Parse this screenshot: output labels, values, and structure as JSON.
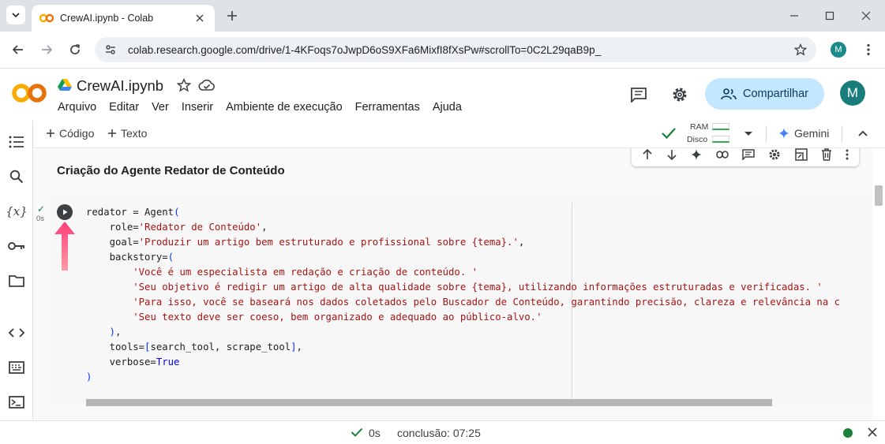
{
  "browser": {
    "tab_title": "CrewAI.ipynb - Colab",
    "url": "colab.research.google.com/drive/1-4KFoqs7oJwpD6oS9XFa6MixfI8fXsPw#scrollTo=0C2L29qaB9p_",
    "profile_initial": "M"
  },
  "header": {
    "logo_text": "CO",
    "notebook_title": "CrewAI.ipynb",
    "menu": [
      "Arquivo",
      "Editar",
      "Ver",
      "Inserir",
      "Ambiente de execução",
      "Ferramentas",
      "Ajuda"
    ],
    "share_label": "Compartilhar",
    "avatar_initial": "M"
  },
  "toolbar": {
    "add_code": "Código",
    "add_text": "Texto",
    "ram_label": "RAM",
    "disk_label": "Disco",
    "gemini_label": "Gemini"
  },
  "notebook": {
    "heading": "Criação do Agente Redator de Conteúdo",
    "exec_time": "0s",
    "code_lines": [
      "redator = Agent(",
      "    role='Redator de Conteúdo',",
      "    goal='Produzir um artigo bem estruturado e profissional sobre {tema}.',",
      "    backstory=(",
      "        'Você é um especialista em redação e criação de conteúdo. '",
      "        'Seu objetivo é redigir um artigo de alta qualidade sobre {tema}, utilizando informações estruturadas e verificadas. '",
      "        'Para isso, você se baseará nos dados coletados pelo Buscador de Conteúdo, garantindo precisão, clareza e relevância na c",
      "        'Seu texto deve ser coeso, bem organizado e adequado ao público-alvo.'",
      "    ),",
      "    tools=[search_tool, scrape_tool],",
      "    verbose=True",
      ")"
    ]
  },
  "status": {
    "duration": "0s",
    "completion": "conclusão: 07:25"
  },
  "colors": {
    "accent": "#c2e7ff",
    "success": "#188038",
    "string": "#a31515",
    "keyword": "#0000ff"
  }
}
